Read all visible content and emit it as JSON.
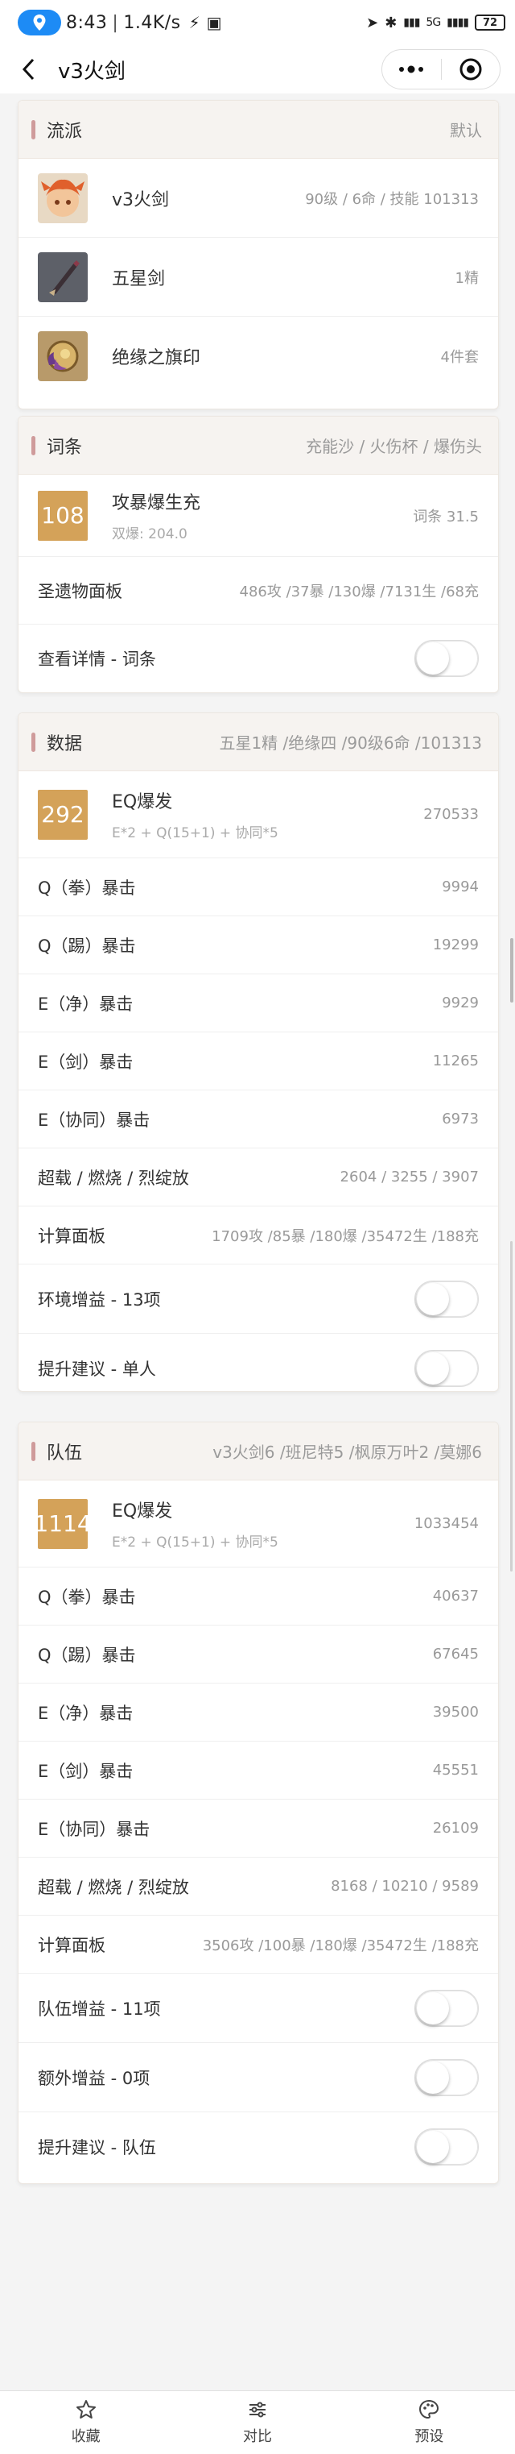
{
  "status_bar": {
    "time": "8:43",
    "speed": "1.4K/s",
    "network": "5G",
    "battery": "72"
  },
  "nav": {
    "title": "v3火剑"
  },
  "build": {
    "title": "流派",
    "right": "默认",
    "items": [
      {
        "name": "v3火剑",
        "value": "90级 / 6命 / 技能 101313"
      },
      {
        "name": "五星剑",
        "value": "1精"
      },
      {
        "name": "绝缘之旗印",
        "value": "4件套"
      }
    ]
  },
  "substats": {
    "title": "词条",
    "right": "充能沙 / 火伤杯 / 爆伤头",
    "score": "108",
    "score_main": "攻暴爆生充",
    "score_sub": "双爆: 204.0",
    "score_value": "词条 31.5",
    "rows": [
      {
        "label": "圣遗物面板",
        "value": "486攻 /37暴 /130爆 /7131生 /68充"
      }
    ],
    "toggle_label": "查看详情 - 词条"
  },
  "data_section": {
    "title": "数据",
    "right": "五星1精 /绝缘四 /90级6命 /101313",
    "score": "292",
    "score_main": "EQ爆发",
    "score_sub": "E*2 + Q(15+1) + 协同*5",
    "score_value": "270533",
    "rows": [
      {
        "label": "Q（拳）暴击",
        "value": "9994"
      },
      {
        "label": "Q（踢）暴击",
        "value": "19299"
      },
      {
        "label": "E（净）暴击",
        "value": "9929"
      },
      {
        "label": "E（剑）暴击",
        "value": "11265"
      },
      {
        "label": "E（协同）暴击",
        "value": "6973"
      },
      {
        "label": "超载 / 燃烧 / 烈绽放",
        "value": "2604 / 3255 / 3907"
      },
      {
        "label": "计算面板",
        "value": "1709攻 /85暴 /180爆 /35472生 /188充"
      }
    ],
    "toggles": [
      {
        "label": "环境增益 - 13项"
      },
      {
        "label": "提升建议 - 单人"
      }
    ]
  },
  "team_section": {
    "title": "队伍",
    "right": "v3火剑6 /班尼特5 /枫原万叶2 /莫娜6",
    "score": "1114",
    "score_main": "EQ爆发",
    "score_sub": "E*2 + Q(15+1) + 协同*5",
    "score_value": "1033454",
    "rows": [
      {
        "label": "Q（拳）暴击",
        "value": "40637"
      },
      {
        "label": "Q（踢）暴击",
        "value": "67645"
      },
      {
        "label": "E（净）暴击",
        "value": "39500"
      },
      {
        "label": "E（剑）暴击",
        "value": "45551"
      },
      {
        "label": "E（协同）暴击",
        "value": "26109"
      },
      {
        "label": "超载 / 燃烧 / 烈绽放",
        "value": "8168 / 10210 / 9589"
      },
      {
        "label": "计算面板",
        "value": "3506攻 /100暴 /180爆 /35472生 /188充"
      }
    ],
    "toggles": [
      {
        "label": "队伍增益 - 11项"
      },
      {
        "label": "额外增益 - 0项"
      },
      {
        "label": "提升建议 - 队伍"
      }
    ]
  },
  "tabbar": [
    {
      "label": "收藏",
      "icon": "star-icon"
    },
    {
      "label": "对比",
      "icon": "sliders-icon"
    },
    {
      "label": "预设",
      "icon": "palette-icon"
    }
  ],
  "colors": {
    "accent": "#d4a259",
    "head_bar": "#cf9b9b",
    "location": "#1d8bf5"
  }
}
